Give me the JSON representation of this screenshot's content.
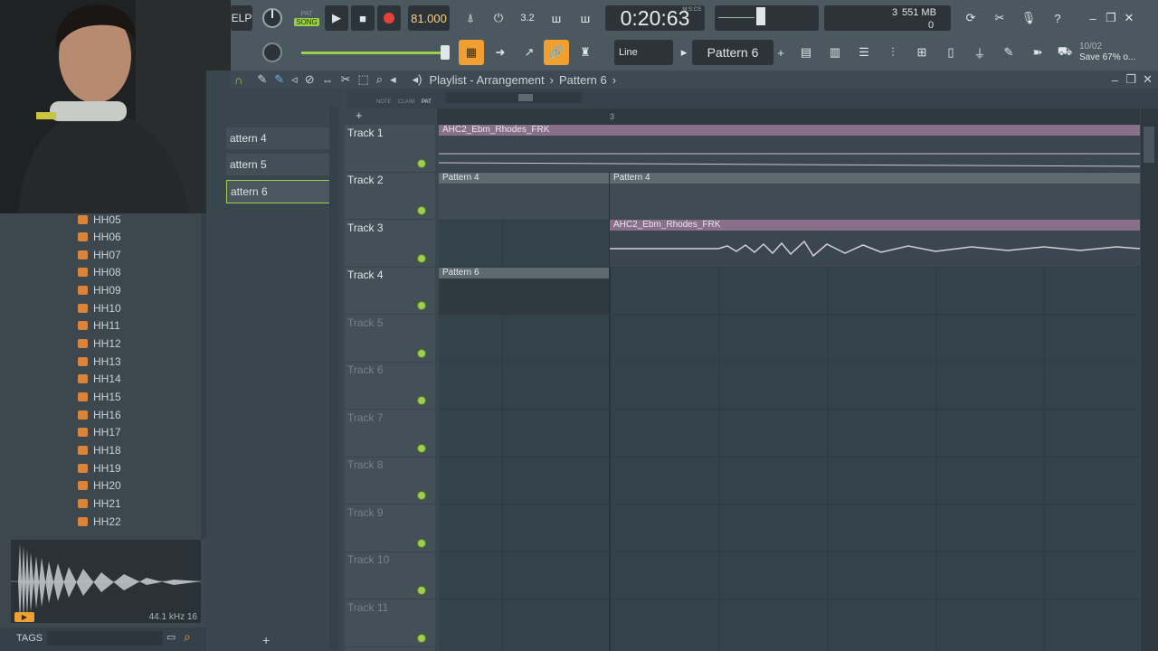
{
  "toolbar": {
    "menu_label": "ELP",
    "song_label": "SONG",
    "pat_label": "PAT",
    "tempo": "81.000",
    "time": "0:20:63",
    "time_unit": "M:S:CS",
    "cpu_value": "3",
    "memory": "551 MB",
    "poly": "0",
    "snap_mode": "Line",
    "pattern_selector": "Pattern 6",
    "hint_date": "10/02",
    "hint_text": "Save 67% o..."
  },
  "browser": {
    "items": [
      "HH05",
      "HH06",
      "HH07",
      "HH08",
      "HH09",
      "HH10",
      "HH11",
      "HH12",
      "HH13",
      "HH14",
      "HH15",
      "HH16",
      "HH17",
      "HH18",
      "HH19",
      "HH20",
      "HH21",
      "HH22"
    ],
    "sample_info": "44.1 kHz 16",
    "tags_label": "TAGS"
  },
  "picker": {
    "patterns": [
      "attern 4",
      "attern 5",
      "attern 6"
    ],
    "add_label": "+"
  },
  "playlist": {
    "title": "Playlist - Arrangement",
    "separator": "›",
    "current_pattern": "Pattern 6",
    "timeline_marker": "3",
    "tool_labels": [
      "NOTE",
      "CLAIM",
      "PAT"
    ],
    "tracks": [
      "Track 1",
      "Track 2",
      "Track 3",
      "Track 4",
      "Track 5",
      "Track 6",
      "Track 7",
      "Track 8",
      "Track 9",
      "Track 10",
      "Track 11"
    ],
    "clips": [
      {
        "track": 1,
        "name": "AHC2_Ebm_Rhodes_FRK",
        "kind": "audio"
      },
      {
        "track": 2,
        "name": "Pattern 4",
        "kind": "pattern"
      },
      {
        "track": 2,
        "name": "Pattern 4",
        "kind": "pattern"
      },
      {
        "track": 3,
        "name": "AHC2_Ebm_Rhodes_FRK",
        "kind": "audio"
      },
      {
        "track": 4,
        "name": "Pattern 6",
        "kind": "pattern"
      }
    ]
  },
  "colors": {
    "accent": "#f0a030",
    "led": "#9ccf4a",
    "audio_clip": "#8a6f8a",
    "record": "#e8403a"
  }
}
